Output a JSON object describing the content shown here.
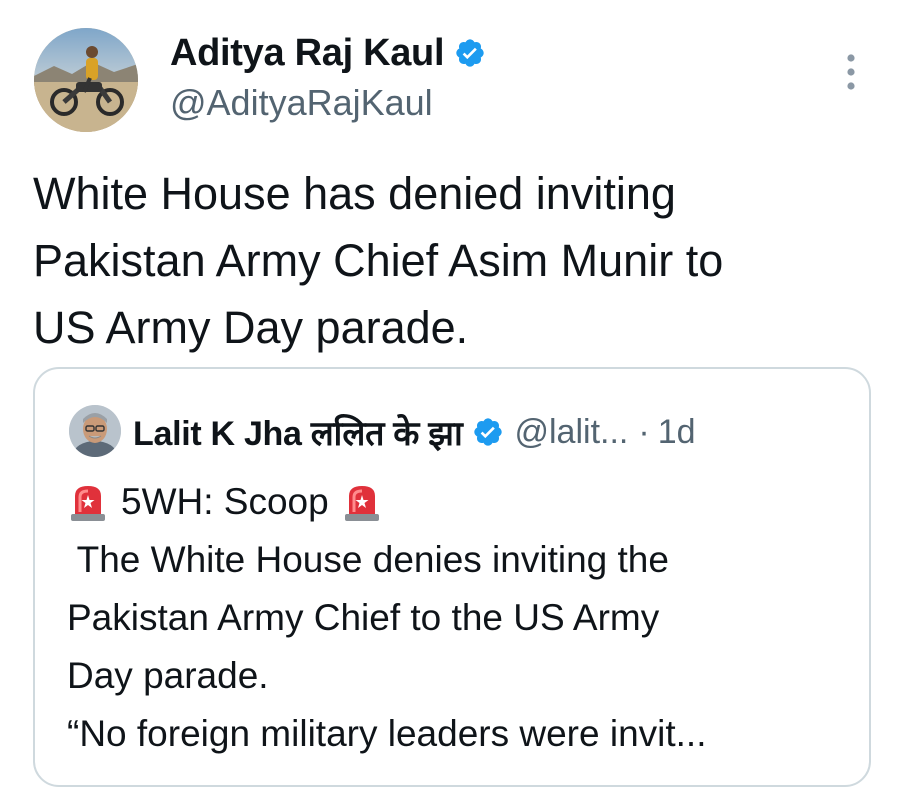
{
  "author": {
    "name": "Aditya Raj Kaul",
    "handle": "@AdityaRajKaul",
    "verified": true
  },
  "tweet": {
    "text_lines": [
      "White House has denied inviting",
      "Pakistan Army Chief Asim Munir to",
      "US Army Day parade."
    ]
  },
  "quoted_tweet": {
    "name": "Lalit K Jha ललित के झा",
    "handle": "@lalit...",
    "separator": "·",
    "time": "1d",
    "verified": true,
    "scoop_label": "5WH: Scoop",
    "body_lines": [
      " The White House denies inviting the",
      "Pakistan Army Chief to the US Army",
      "Day parade.",
      "“No foreign military leaders were invit..."
    ]
  },
  "icons": {
    "verified": "verified-badge-icon",
    "more": "more-vertical-icon",
    "siren": "police-siren-emoji"
  },
  "colors": {
    "verified_blue": "#1d9bf0",
    "secondary_text": "#536471",
    "border": "#cfd9de",
    "siren_red": "#e0313b"
  }
}
